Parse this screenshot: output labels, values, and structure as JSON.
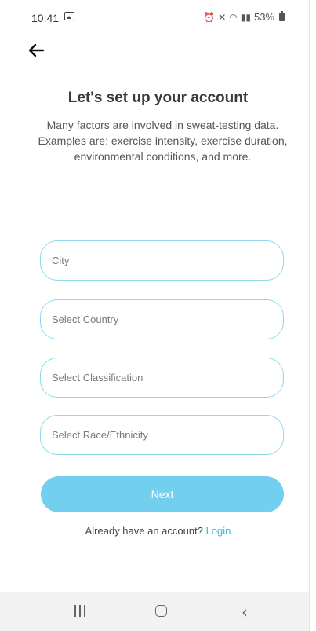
{
  "status_bar": {
    "time": "10:41",
    "battery": "53%",
    "icons": [
      "image-icon",
      "alarm-icon",
      "mute-icon",
      "wifi-icon",
      "signal-icon",
      "battery-icon"
    ]
  },
  "header": {
    "back_icon": "arrow-left-icon"
  },
  "content": {
    "title": "Let's set up your account",
    "subtitle": "Many factors are involved in sweat-testing data. Examples are: exercise intensity, exercise duration, environmental conditions, and more."
  },
  "form": {
    "city": {
      "placeholder": "City",
      "value": ""
    },
    "country": {
      "placeholder": "Select Country",
      "value": ""
    },
    "classification": {
      "placeholder": "Select Classification",
      "value": ""
    },
    "race": {
      "placeholder": "Select Race/Ethnicity",
      "value": ""
    }
  },
  "actions": {
    "next_label": "Next",
    "login_prompt": "Already have an account?",
    "login_label": "Login"
  },
  "nav": {
    "icons": [
      "recents-icon",
      "home-icon",
      "back-icon"
    ]
  },
  "colors": {
    "accent": "#72d0ee",
    "border": "#8fd8ef",
    "link": "#3fb4e0",
    "nav_bg": "#f2f2f2"
  }
}
